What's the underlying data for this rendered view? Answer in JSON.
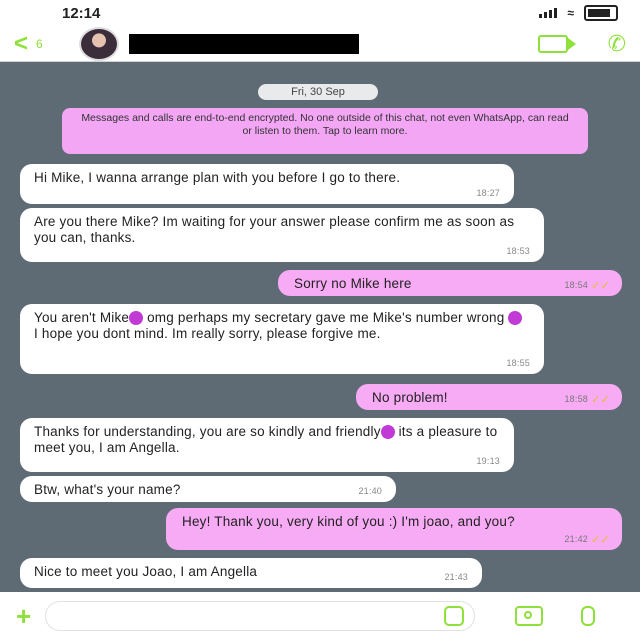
{
  "status": {
    "time": "12:14"
  },
  "header": {
    "back_count": "6"
  },
  "date_label": "Fri, 30 Sep",
  "encryption_notice": "Messages and calls are end-to-end encrypted. No one outside of this chat, not even WhatsApp, can read or listen to them. Tap to learn more.",
  "messages": [
    {
      "dir": "in",
      "text": "Hi Mike, I wanna arrange plan with you before I go to there.",
      "time": "18:27"
    },
    {
      "dir": "in",
      "text": "Are you there Mike? Im waiting for your answer please confirm me as soon as you can, thanks.",
      "time": "18:53"
    },
    {
      "dir": "out",
      "text": "Sorry no Mike here",
      "time": "18:54"
    },
    {
      "dir": "in",
      "text_a": "You aren't Mike",
      "text_b": " omg perhaps my secretary gave me Mike's number wrong",
      "text_c": " I hope you dont mind. Im really sorry, please forgive me.",
      "time": "18:55"
    },
    {
      "dir": "out",
      "text": "No problem!",
      "time": "18:58"
    },
    {
      "dir": "in",
      "text_a": "Thanks for understanding, you are so kindly and friendly",
      "text_b": " its a pleasure to meet you, I am Angella.",
      "time": "19:13"
    },
    {
      "dir": "in",
      "text": "Btw, what's your name?",
      "time": "21:40"
    },
    {
      "dir": "out",
      "text": "Hey! Thank you, very kind of you :) I'm joao, and you?",
      "time": "21:42"
    },
    {
      "dir": "in",
      "text": "Nice to meet you Joao, I am Angella",
      "time": "21:43"
    }
  ],
  "ticks": "✓✓",
  "icons": [
    "back-icon",
    "video-call-icon",
    "phone-call-icon",
    "plus-icon",
    "sticker-icon",
    "camera-icon",
    "mic-icon"
  ],
  "colors": {
    "accent": "#8ee03a",
    "outgoing": "#f7abf5",
    "incoming": "#ffffff",
    "chat_bg": "#5f6b74",
    "notice": "#f2a6f4"
  }
}
